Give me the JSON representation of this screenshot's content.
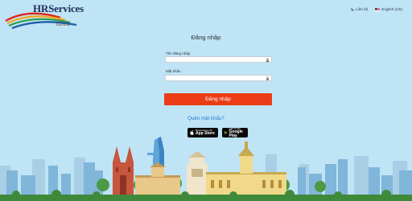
{
  "logo": {
    "brand": "HRServices",
    "tagline": "Talentnet"
  },
  "topbar": {
    "contact": "Liên hệ",
    "language": "English (US)"
  },
  "form": {
    "title": "Đăng nhập",
    "username_label": "Tên đăng nhập",
    "username_value": "",
    "password_label": "Mật khẩu",
    "password_value": "",
    "submit_label": "Đăng nhập",
    "forgot_label": "Quên mật khẩu?"
  },
  "stores": {
    "appstore_small": "Download on the",
    "appstore_big": "App Store",
    "googleplay_small": "GET IT ON",
    "googleplay_big": "Google Play"
  },
  "colors": {
    "background": "#bfe4f6",
    "primary_button": "#ec3c17",
    "link": "#2979c9"
  }
}
